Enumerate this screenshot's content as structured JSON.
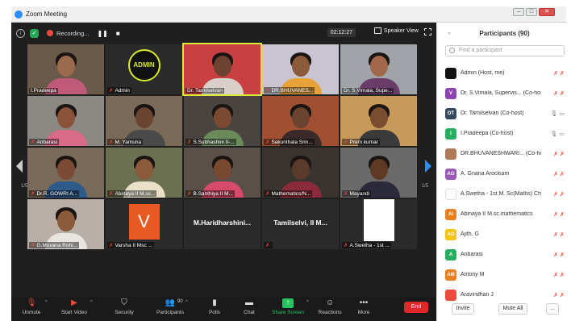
{
  "window": {
    "title": "Zoom Meeting"
  },
  "topbar": {
    "recording_label": "Recording...",
    "timer": "02:12:27",
    "speaker_view_label": "Speaker View"
  },
  "pager": {
    "left": "1/5",
    "right": "1/5"
  },
  "tiles": [
    {
      "name": "I.Pradeepa",
      "muted": false,
      "kind": "photo",
      "skin": "#9b6a4c",
      "cloth": "#c05a7a",
      "bg": "#6b5a4a"
    },
    {
      "name": "Admin",
      "muted": true,
      "kind": "admin"
    },
    {
      "name": "Dr. Tamilselvan",
      "muted": false,
      "kind": "photo",
      "active": true,
      "skin": "#6e4230",
      "cloth": "#d8d0c8",
      "bg": "#c84040"
    },
    {
      "name": "DR.BHUVANES...",
      "muted": true,
      "kind": "photo",
      "skin": "#8a5a3a",
      "cloth": "#e8a23a",
      "bg": "#c8c4d0"
    },
    {
      "name": "Dr. S.Vimala, Supe...",
      "muted": false,
      "kind": "photo",
      "skin": "#a06848",
      "cloth": "#6a3c6a",
      "bg": "#a0a4a8"
    },
    {
      "name": "Anbarasi",
      "muted": true,
      "kind": "photo",
      "skin": "#8a5238",
      "cloth": "#d86a8a",
      "bg": "#8c8884"
    },
    {
      "name": "M. Yamuna",
      "muted": true,
      "kind": "photo",
      "skin": "#6a4632",
      "cloth": "#4a4a4a",
      "bg": "#7a6a58"
    },
    {
      "name": "S.Subhashini II-...",
      "muted": true,
      "kind": "photo",
      "skin": "#7a4a32",
      "cloth": "#6a8a5a",
      "bg": "#4a4440"
    },
    {
      "name": "Sakunthala Srin...",
      "muted": true,
      "kind": "photo",
      "skin": "#6a4430",
      "cloth": "#3a2a2a",
      "bg": "#a05030"
    },
    {
      "name": "Prem kumar",
      "muted": true,
      "kind": "photo",
      "skin": "#7a4c30",
      "cloth": "#3a3a3a",
      "bg": "#c89a5a"
    },
    {
      "name": "Dr.R. GOWRI A...",
      "muted": true,
      "kind": "photo",
      "skin": "#7a4a34",
      "cloth": "#2e5a8a",
      "bg": "#7a6a5a"
    },
    {
      "name": "Abinaya II M.sc...",
      "muted": true,
      "kind": "photo",
      "skin": "#8a5a3a",
      "cloth": "#e8e0c8",
      "bg": "#6a7050"
    },
    {
      "name": "B.Santhiya II M...",
      "muted": true,
      "kind": "photo",
      "skin": "#7a4830",
      "cloth": "#d84a6a",
      "bg": "#5a504a"
    },
    {
      "name": "Mathematics/N...",
      "muted": true,
      "kind": "photo",
      "skin": "#5a3a28",
      "cloth": "#8a2a3a",
      "bg": "#3a3430"
    },
    {
      "name": "Mayandi",
      "muted": true,
      "kind": "photo",
      "skin": "#5e3a26",
      "cloth": "#2a2a3a",
      "bg": "#6a6a6a"
    },
    {
      "name": "G.Muvana Rohi...",
      "muted": true,
      "kind": "photo",
      "skin": "#8a5a3a",
      "cloth": "#e8e4e0",
      "bg": "#b8b0a8"
    },
    {
      "name": "Varsha II Msc ...",
      "muted": true,
      "kind": "letter",
      "letter": "V"
    },
    {
      "name": "",
      "muted": false,
      "kind": "text",
      "center": "M.Haridharshini..."
    },
    {
      "name": "",
      "muted": true,
      "kind": "text",
      "center": "Tamilselvi, II M..."
    },
    {
      "name": "A.Swetha - 1st ...",
      "muted": true,
      "kind": "white"
    }
  ],
  "toolbar": {
    "mute": "Unmute",
    "video": "Start Video",
    "security": "Security",
    "participants": "Participants",
    "participants_count": "90",
    "polls": "Polls",
    "chat": "Chat",
    "share": "Share Screen",
    "reactions": "Reactions",
    "more": "More",
    "end": "End"
  },
  "panel": {
    "title": "Participants (90)",
    "search_placeholder": "Find a participant",
    "invite": "Invite",
    "mute_all": "Mute All",
    "more": "...",
    "participants": [
      {
        "initials": "",
        "name": "Admin (Host, me)",
        "color": "#111111",
        "status": "muted"
      },
      {
        "initials": "V",
        "name": "Dr. S.Vimala, Supervis... (Co-host)",
        "color": "#8e44ad",
        "status": "muted"
      },
      {
        "initials": "DT",
        "name": "Dr. Tamilselvan (Co-host)",
        "color": "#34495e",
        "status": "ok"
      },
      {
        "initials": "I",
        "name": "I.Pradeepa (Co-host)",
        "color": "#27ae60",
        "status": "ok"
      },
      {
        "initials": "",
        "name": "DR.BHUVANESHWARI... (Co-host)",
        "color": "#b07a5a",
        "status": "muted"
      },
      {
        "initials": "AG",
        "name": "A. Gnana Arockiam",
        "color": "#9b59b6",
        "status": "muted"
      },
      {
        "initials": "",
        "name": "A.Swetha - 1st M. Sc(Maths) Ch...",
        "color": "#ffffff",
        "status": "muted"
      },
      {
        "initials": "AI",
        "name": "Abinaya II M.sc.mathematics",
        "color": "#e67e22",
        "status": "muted"
      },
      {
        "initials": "AG",
        "name": "Ajith. G",
        "color": "#f1c40f",
        "status": "muted"
      },
      {
        "initials": "A",
        "name": "Anbarasi",
        "color": "#27ae60",
        "status": "muted"
      },
      {
        "initials": "AM",
        "name": "Antony M",
        "color": "#e67e22",
        "status": "muted"
      },
      {
        "initials": "",
        "name": "Aravindhan J",
        "color": "#e74c3c",
        "status": "muted"
      }
    ]
  }
}
